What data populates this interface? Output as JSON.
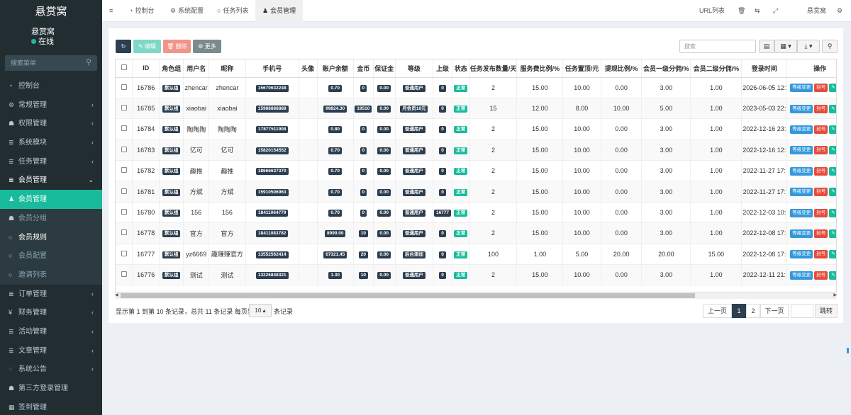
{
  "sidebar": {
    "logo": "悬赏窝",
    "user_name": "悬赏窝",
    "user_status": "在线",
    "search_placeholder": "搜索菜单",
    "items": [
      {
        "label": "控制台",
        "icon": "dashboard-icon",
        "glyph": "◔",
        "type": "top"
      },
      {
        "label": "常规管理",
        "icon": "cogs-icon",
        "glyph": "⚙",
        "type": "top",
        "arrow": "‹"
      },
      {
        "label": "权限管理",
        "icon": "group-icon",
        "glyph": "☗",
        "type": "top",
        "arrow": "‹"
      },
      {
        "label": "系统模块",
        "icon": "list-icon",
        "glyph": "≣",
        "type": "top",
        "arrow": "‹"
      },
      {
        "label": "任务管理",
        "icon": "list-icon",
        "glyph": "≣",
        "type": "top",
        "arrow": "‹"
      },
      {
        "label": "会员管理",
        "icon": "list-icon",
        "glyph": "≣",
        "type": "open",
        "arrow": "⌄"
      },
      {
        "label": "会员管理",
        "icon": "user-icon",
        "glyph": "♟",
        "type": "active"
      },
      {
        "label": "会员分组",
        "icon": "users-icon",
        "glyph": "☗",
        "type": "sub"
      },
      {
        "label": "会员规则",
        "icon": "circle-icon",
        "glyph": "○",
        "type": "sub curr"
      },
      {
        "label": "会员配置",
        "icon": "circle-icon",
        "glyph": "○",
        "type": "sub"
      },
      {
        "label": "邀请列表",
        "icon": "circle-icon",
        "glyph": "○",
        "type": "sub"
      },
      {
        "label": "订单管理",
        "icon": "list-icon",
        "glyph": "≣",
        "type": "top",
        "arrow": "‹"
      },
      {
        "label": "财务管理",
        "icon": "yen-icon",
        "glyph": "¥",
        "type": "top",
        "arrow": "‹"
      },
      {
        "label": "活动管理",
        "icon": "list-icon",
        "glyph": "≣",
        "type": "top",
        "arrow": "‹"
      },
      {
        "label": "文章管理",
        "icon": "list-icon",
        "glyph": "≣",
        "type": "top",
        "arrow": "‹"
      },
      {
        "label": "系统公告",
        "icon": "comment-icon",
        "glyph": "◌",
        "type": "top",
        "arrow": "‹"
      },
      {
        "label": "第三方登录管理",
        "icon": "users-icon",
        "glyph": "☗",
        "type": "top"
      },
      {
        "label": "签到管理",
        "icon": "calendar-icon",
        "glyph": "▦",
        "type": "top"
      }
    ]
  },
  "header": {
    "menu_icon": "≡",
    "tabs": [
      {
        "label": "控制台",
        "icon": "dashboard-icon",
        "glyph": "◔"
      },
      {
        "label": "系统配置",
        "icon": "gear-icon",
        "glyph": "⚙"
      },
      {
        "label": "任务列表",
        "icon": "circle-icon",
        "glyph": "○"
      },
      {
        "label": "会员管理",
        "icon": "user-icon",
        "glyph": "♟"
      }
    ],
    "url_list": "URL列表",
    "trash_icon": "🗑",
    "lang_icon": "⇆",
    "fullscreen_icon": "⤢",
    "site_name": "悬赏窝",
    "settings_icon": "⚙"
  },
  "toolbar": {
    "refresh_icon": "↻",
    "edit_label": "✎ 编辑",
    "delete_label": "🗑 删除",
    "more_label": "⚙ 更多",
    "search_placeholder": "搜索",
    "view_icon": "▤",
    "columns_icon": "▦ ▾",
    "export_icon": "⤓ ▾",
    "search_icon": "⚲"
  },
  "table": {
    "headers": [
      "ID",
      "角色组",
      "用户名",
      "昵称",
      "手机号",
      "头像",
      "账户余额",
      "金币",
      "保证金",
      "等级",
      "上级",
      "状态",
      "任务发布数量/天",
      "服务费比例/%",
      "任务置顶/元",
      "提现比例/%",
      "会员一级分佣/%",
      "会员二级分佣/%",
      "登录时间",
      "操作"
    ],
    "rows": [
      {
        "id": "16786",
        "group": "默认组",
        "username": "zhencar",
        "nickname": "zhencar",
        "mobile": "15670632248",
        "balance": "0.70",
        "coin": "0",
        "deposit": "0.00",
        "level": "普通用户",
        "parent": "0",
        "status": "正常",
        "tasks": "2",
        "fee": "15.00",
        "top": "10.00",
        "withdraw": "0.00",
        "c1": "3.00",
        "c2": "1.00",
        "logintime": "2026-06-05 12:"
      },
      {
        "id": "16785",
        "group": "默认组",
        "username": "xiaobai",
        "nickname": "xiaobai",
        "mobile": "15988888888",
        "balance": "99824.30",
        "coin": "19510",
        "deposit": "0.00",
        "level": "月会员18元",
        "parent": "0",
        "status": "正常",
        "tasks": "15",
        "fee": "12.00",
        "top": "8.00",
        "withdraw": "10.00",
        "c1": "5.00",
        "c2": "1.00",
        "logintime": "2023-05-03 22:"
      },
      {
        "id": "16784",
        "group": "默认组",
        "username": "陶陶陶",
        "nickname": "陶陶陶",
        "mobile": "17877511908",
        "balance": "0.80",
        "coin": "0",
        "deposit": "0.00",
        "level": "普通用户",
        "parent": "0",
        "status": "正常",
        "tasks": "2",
        "fee": "15.00",
        "top": "10.00",
        "withdraw": "0.00",
        "c1": "3.00",
        "c2": "1.00",
        "logintime": "2022-12-16 23:"
      },
      {
        "id": "16783",
        "group": "默认组",
        "username": "亿可",
        "nickname": "亿可",
        "mobile": "15820154552",
        "balance": "0.70",
        "coin": "0",
        "deposit": "0.00",
        "level": "普通用户",
        "parent": "0",
        "status": "正常",
        "tasks": "2",
        "fee": "15.00",
        "top": "10.00",
        "withdraw": "0.00",
        "c1": "3.00",
        "c2": "1.00",
        "logintime": "2022-12-16 12:"
      },
      {
        "id": "16782",
        "group": "默认组",
        "username": "趣推",
        "nickname": "趣推",
        "mobile": "18666637370",
        "balance": "0.70",
        "coin": "0",
        "deposit": "0.00",
        "level": "普通用户",
        "parent": "0",
        "status": "正常",
        "tasks": "2",
        "fee": "15.00",
        "top": "10.00",
        "withdraw": "0.00",
        "c1": "3.00",
        "c2": "1.00",
        "logintime": "2022-11-27 17:"
      },
      {
        "id": "16781",
        "group": "默认组",
        "username": "方斌",
        "nickname": "方斌",
        "mobile": "15910506963",
        "balance": "0.70",
        "coin": "0",
        "deposit": "0.00",
        "level": "普通用户",
        "parent": "0",
        "status": "正常",
        "tasks": "2",
        "fee": "15.00",
        "top": "10.00",
        "withdraw": "0.00",
        "c1": "3.00",
        "c2": "1.00",
        "logintime": "2022-11-27 17:"
      },
      {
        "id": "16780",
        "group": "默认组",
        "username": "156",
        "nickname": "156",
        "mobile": "18411064779",
        "balance": "0.70",
        "coin": "0",
        "deposit": "0.00",
        "level": "普通用户",
        "parent": "16777",
        "status": "正常",
        "tasks": "2",
        "fee": "15.00",
        "top": "10.00",
        "withdraw": "0.00",
        "c1": "3.00",
        "c2": "1.00",
        "logintime": "2022-12-03 10:"
      },
      {
        "id": "16778",
        "group": "默认组",
        "username": "官方",
        "nickname": "官方",
        "mobile": "18411083782",
        "balance": "8999.00",
        "coin": "10",
        "deposit": "0.00",
        "level": "普通用户",
        "parent": "0",
        "status": "正常",
        "tasks": "2",
        "fee": "15.00",
        "top": "10.00",
        "withdraw": "0.00",
        "c1": "3.00",
        "c2": "1.00",
        "logintime": "2022-12-08 17:"
      },
      {
        "id": "16777",
        "group": "默认组",
        "username": "yz6669",
        "nickname": "趣赚赚官方",
        "mobile": "13552562414",
        "balance": "67321.45",
        "coin": "20",
        "deposit": "0.00",
        "level": "后台添加",
        "parent": "0",
        "status": "正常",
        "tasks": "100",
        "fee": "1.00",
        "top": "5.00",
        "withdraw": "20.00",
        "c1": "20.00",
        "c2": "15.00",
        "logintime": "2022-12-08 17:"
      },
      {
        "id": "16776",
        "group": "默认组",
        "username": "测试",
        "nickname": "测试",
        "mobile": "13226848321",
        "balance": "1.30",
        "coin": "10",
        "deposit": "0.00",
        "level": "普通用户",
        "parent": "0",
        "status": "正常",
        "tasks": "2",
        "fee": "15.00",
        "top": "10.00",
        "withdraw": "0.00",
        "c1": "3.00",
        "c2": "1.00",
        "logintime": "2022-12-11 21:"
      }
    ],
    "op_level": "等级变更",
    "op_ban": "封号",
    "op_edit_icon": "✎"
  },
  "footer": {
    "summary": "显示第 1 到第 10 条记录，总共 11 条记录 每页显示",
    "page_size": "10 ▴",
    "suffix": "条记录",
    "prev": "上一页",
    "pages": [
      "1",
      "2"
    ],
    "next": "下一页",
    "jump": "跳转"
  }
}
